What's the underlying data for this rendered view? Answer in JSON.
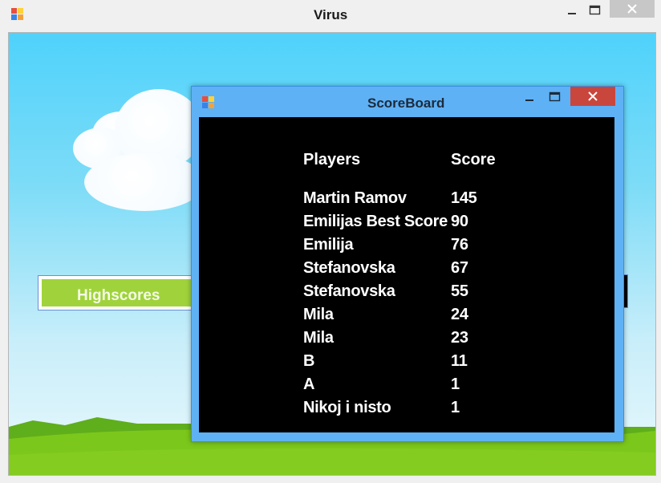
{
  "window": {
    "title": "Virus"
  },
  "main": {
    "highscores_label": "Highscores"
  },
  "scoreboard": {
    "title": "ScoreBoard",
    "headers": {
      "players": "Players",
      "score": "Score"
    },
    "rows": [
      {
        "player": "Martin Ramov",
        "score": "145"
      },
      {
        "player": "Emilijas Best Score",
        "score": "90"
      },
      {
        "player": "Emilija",
        "score": "76"
      },
      {
        "player": "Stefanovska",
        "score": "67"
      },
      {
        "player": "Stefanovska",
        "score": "55"
      },
      {
        "player": "Mila",
        "score": "24"
      },
      {
        "player": "Mila",
        "score": "23"
      },
      {
        "player": "B",
        "score": "11"
      },
      {
        "player": "A",
        "score": "1"
      },
      {
        "player": "Nikoj i nisto",
        "score": "1"
      }
    ]
  },
  "icons": {
    "app": "app-icon",
    "minimize": "minimize-icon",
    "maximize": "maximize-icon",
    "close": "close-icon"
  },
  "colors": {
    "sky": "#4fd2fb",
    "grass": "#7cc71b",
    "button_green": "#a0d33b",
    "dialog_frame": "#5eb1f5",
    "close_red": "#c9463d"
  }
}
